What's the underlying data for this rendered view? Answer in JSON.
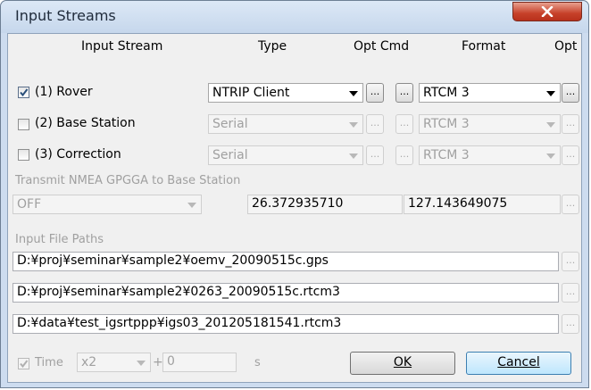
{
  "window": {
    "title": "Input Streams"
  },
  "headers": {
    "input_stream": "Input Stream",
    "type": "Type",
    "opt_cmd": "Opt Cmd",
    "format": "Format",
    "opt": "Opt"
  },
  "streams": [
    {
      "label": "(1) Rover",
      "checked": true,
      "type": "NTRIP Client",
      "format": "RTCM 3",
      "enabled": true
    },
    {
      "label": "(2) Base Station",
      "checked": false,
      "type": "Serial",
      "format": "RTCM 3",
      "enabled": false
    },
    {
      "label": "(3) Correction",
      "checked": false,
      "type": "Serial",
      "format": "RTCM 3",
      "enabled": false
    }
  ],
  "button_glyph": "...",
  "nmea": {
    "label": "Transmit NMEA GPGGA to Base Station",
    "mode": "OFF",
    "lat": "26.372935710",
    "lon": "127.143649075"
  },
  "file_paths": {
    "label": "Input File Paths",
    "paths": [
      "D:¥proj¥seminar¥sample2¥oemv_20090515c.gps",
      "D:¥proj¥seminar¥sample2¥0263_20090515c.rtcm3",
      "D:¥data¥test_igsrtppp¥igs03_201205181541.rtcm3"
    ]
  },
  "time": {
    "label": "Time",
    "speed": "x2",
    "plus": "+",
    "offset": "0",
    "unit": "s"
  },
  "buttons": {
    "ok": "OK",
    "cancel": "Cancel"
  },
  "colors": {
    "title_bg": "#cddcef",
    "close_red": "#c7412a",
    "client_bg": "#f0f0f0"
  }
}
